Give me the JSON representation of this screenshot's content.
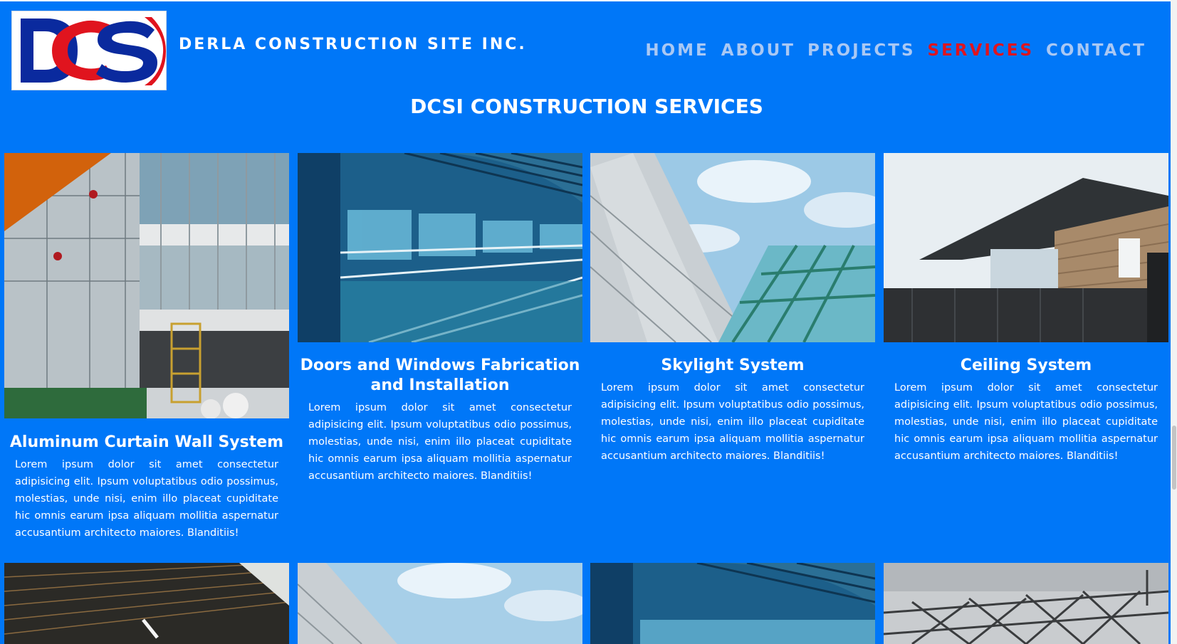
{
  "brand": {
    "logo_text": "DCSI",
    "name": "DERLA CONSTRUCTION SITE INC."
  },
  "nav": {
    "items": [
      {
        "label": "HOME",
        "active": false
      },
      {
        "label": "ABOUT",
        "active": false
      },
      {
        "label": "PROJECTS",
        "active": false
      },
      {
        "label": "SERVICES",
        "active": true
      },
      {
        "label": "CONTACT",
        "active": false
      }
    ]
  },
  "page_title": "DCSI CONSTRUCTION SERVICES",
  "services": [
    {
      "title": "Aluminum Curtain Wall System",
      "description": "Lorem ipsum dolor sit amet consectetur adipisicing elit. Ipsum voluptatibus odio possimus, molestias, unde nisi, enim illo placeat cupiditate hic omnis earum ipsa aliquam mollitia aspernatur accusantium architecto maiores. Blanditiis!"
    },
    {
      "title": "Doors and Windows Fabrication and Installation",
      "description": "Lorem ipsum dolor sit amet consectetur adipisicing elit. Ipsum voluptatibus odio possimus, molestias, unde nisi, enim illo placeat cupiditate hic omnis earum ipsa aliquam mollitia aspernatur accusantium architecto maiores. Blanditiis!"
    },
    {
      "title": "Skylight System",
      "description": "Lorem ipsum dolor sit amet consectetur adipisicing elit. Ipsum voluptatibus odio possimus, molestias, unde nisi, enim illo placeat cupiditate hic omnis earum ipsa aliquam mollitia aspernatur accusantium architecto maiores. Blanditiis!"
    },
    {
      "title": "Ceiling System",
      "description": "Lorem ipsum dolor sit amet consectetur adipisicing elit. Ipsum voluptatibus odio possimus, molestias, unde nisi, enim illo placeat cupiditate hic omnis earum ipsa aliquam mollitia aspernatur accusantium architecto maiores. Blanditiis!"
    }
  ],
  "colors": {
    "background": "#0077f8",
    "nav_inactive": "#a9c8f4",
    "nav_active": "#e0141e",
    "logo_blue": "#0a2a9e",
    "logo_red": "#e0141e"
  }
}
